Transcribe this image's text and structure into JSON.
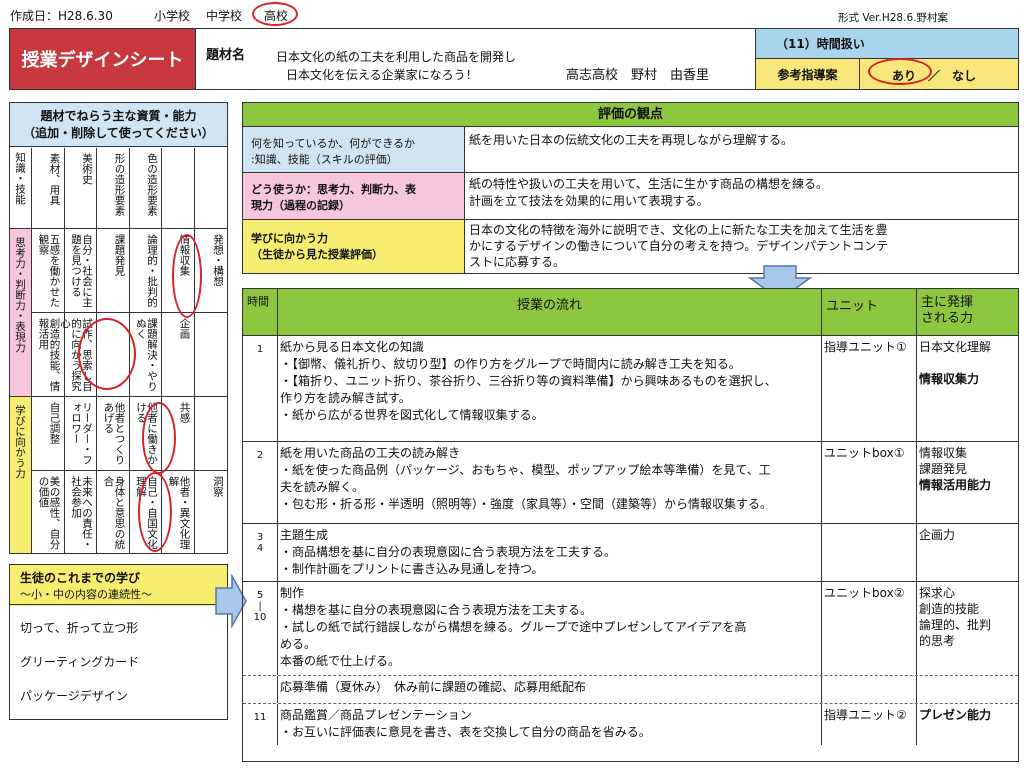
{
  "header": {
    "created_label": "作成日：H28.6.30",
    "school_levels": [
      "小学校",
      "中学校",
      "高校"
    ],
    "format": "形式 Ver.H28.6.野村案"
  },
  "title_box": {
    "title": "授業デザインシート",
    "subject_label": "題材名",
    "subject_line1": "日本文化の紙の工夫を利用した商品を開発し",
    "subject_line2": "日本文化を伝える企業家になろう！",
    "author": "高志高校　野村　由香里",
    "hours": "（11）時間扱い",
    "reference_label": "参考指導案",
    "reference_yes": "あり",
    "reference_sep": "／",
    "reference_no": "なし"
  },
  "abilities": {
    "title_line1": "題材でねらう主な資質・能力",
    "title_line2": "（追加・削除して使ってください）",
    "rows": [
      {
        "label": "知識・技能",
        "cells": [
          "素材、用具",
          "美術史",
          "形の造形要素",
          "色の造形要素",
          "",
          ""
        ]
      },
      {
        "label": "思考力・判断力・表現力",
        "cells": [
          "五感を働かせた観察",
          "自分・社会に主題を見つける",
          "課題発見",
          "論理的・批判的",
          "情報収集",
          "発想・構想"
        ]
      },
      {
        "label": "",
        "cells": [
          "創造的技能、情報活用",
          "試作、思索し目的に向かう探究心",
          "",
          "課題解決・やりぬく",
          "企画",
          ""
        ]
      },
      {
        "label": "学びに向かう力",
        "cells": [
          "自己調整",
          "リーダー・フォロワー",
          "他者とつくりあげる",
          "他者に働きかける",
          "共感",
          ""
        ]
      },
      {
        "label": "",
        "cells": [
          "美の感性、自分の価値",
          "未来への責任・社会参加",
          "身体と意思の統合",
          "自己・自国文化理解",
          "他者・異文化理解",
          "洞察"
        ]
      }
    ]
  },
  "prior_learning": {
    "title": "生徒のこれまでの学び",
    "subtitle": "～小・中の内容の連続性～",
    "items": [
      "切って、折って立つ形",
      "グリーティングカード",
      "パッケージデザイン"
    ]
  },
  "evaluation": {
    "title": "評価の観点",
    "rows": [
      {
        "label1": "何を知っているか、何ができるか",
        "label2": ":知識、技能（スキルの評価）",
        "text1": "紙を用いた日本の伝統文化の工夫を再現しながら理解する。",
        "text2": "",
        "text3": ""
      },
      {
        "label1": "どう使うか：思考力、判断力、表",
        "label2": "現力（過程の記録）",
        "text1": "紙の特性や扱いの工夫を用いて、生活に生かす商品の構想を練る。",
        "text2": "計画を立て技法を効果的に用いて表現する。",
        "text3": ""
      },
      {
        "label1": "学びに向かう力",
        "label2": "（生徒から見た授業評価）",
        "text1": "日本の文化の特徴を海外に説明でき、文化の上に新たな工夫を加えて生活を豊",
        "text2": "かにするデザインの働きについて自分の考えを持つ。デザインパテントコンテ",
        "text3": "ストに応募する。"
      }
    ]
  },
  "lesson": {
    "headers": {
      "time": "時間",
      "flow": "授業の流れ",
      "unit": "ユニット",
      "power_line1": "主に発揮",
      "power_line2": "される力"
    },
    "rows": [
      {
        "time": "1",
        "lines": [
          "紙から見る日本文化の知識",
          "・【御幣、儀礼折り、紋切り型】の作り方をグループで時間内に読み解き工夫を知る。",
          "・【箱折り、ユニット折り、茶谷折り、三谷折り等の資料準備】から興味あるものを選択し、",
          "作り方を読み解き試す。",
          "・紙から広がる世界を図式化して情報収集する。"
        ],
        "unit": "指導ユニット①",
        "powers": [
          "日本文化理解",
          "",
          "情報収集力"
        ]
      },
      {
        "time": "2",
        "lines": [
          "紙を用いた商品の工夫の読み解き",
          "・紙を使った商品例（パッケージ、おもちゃ、模型、ポップアップ絵本等準備）を見て、工",
          "夫を読み解く。",
          "・包む形・折る形・半透明（照明等）・強度（家具等）・空間（建築等）から情報収集する。"
        ],
        "unit": "ユニットbox①",
        "powers": [
          "情報収集",
          "課題発見",
          "情報活用能力"
        ]
      },
      {
        "time": "3\n4",
        "lines": [
          "主題生成",
          "・商品構想を基に自分の表現意図に合う表現方法を工夫する。",
          "・制作計画をプリントに書き込み見通しを持つ。"
        ],
        "unit": "",
        "powers": [
          "企画力"
        ]
      },
      {
        "time": "5\n|\n10",
        "lines": [
          "制作",
          "・構想を基に自分の表現意図に合う表現方法を工夫する。",
          "・試しの紙で試行錯誤しながら構想を練る。グループで途中プレゼンしてアイデアを高",
          "める。",
          "本番の紙で仕上げる。"
        ],
        "unit": "ユニットbox②",
        "powers": [
          "探求心",
          "創造的技能",
          "論理的、批判",
          "的思考"
        ]
      },
      {
        "time": "",
        "lines": [
          "応募準備（夏休み）　休み前に課題の確認、応募用紙配布"
        ],
        "unit": "",
        "powers": []
      },
      {
        "time": "11",
        "lines": [
          "商品鑑賞／商品プレゼンテーション",
          "・お互いに評価表に意見を書き、表を交換して自分の商品を省みる。"
        ],
        "unit": "指導ユニット②",
        "powers": [
          "プレゼン能力"
        ]
      }
    ]
  },
  "colors": {
    "title_red": "#c7393e",
    "green": "#8dc63f",
    "blue": "#a9d5ec",
    "pink": "#f6c7dc",
    "yellow": "#f7ee71",
    "light_blue": "#cfe5f4",
    "ring": "#d9222a"
  }
}
